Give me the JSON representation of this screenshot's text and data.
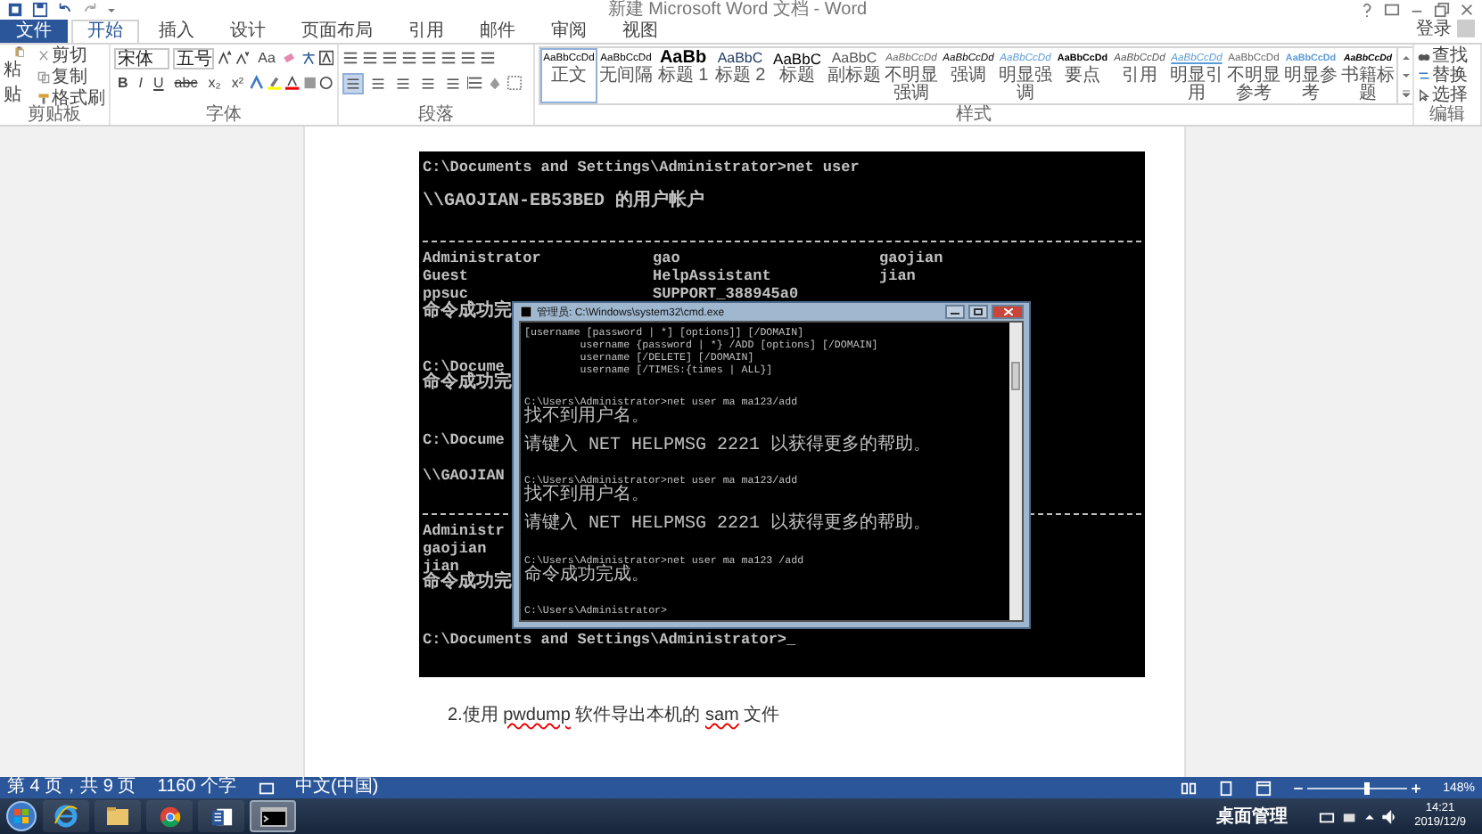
{
  "window": {
    "title": "新建 Microsoft Word 文档 - Word",
    "sign_in": "登录"
  },
  "tabs": [
    {
      "label": "文件",
      "kind": "file",
      "selected": false
    },
    {
      "label": "开始",
      "kind": "tab",
      "selected": true
    },
    {
      "label": "插入",
      "kind": "tab",
      "selected": false
    },
    {
      "label": "设计",
      "kind": "tab",
      "selected": false
    },
    {
      "label": "页面布局",
      "kind": "tab",
      "selected": false
    },
    {
      "label": "引用",
      "kind": "tab",
      "selected": false
    },
    {
      "label": "邮件",
      "kind": "tab",
      "selected": false
    },
    {
      "label": "审阅",
      "kind": "tab",
      "selected": false
    },
    {
      "label": "视图",
      "kind": "tab",
      "selected": false
    }
  ],
  "clipboard": {
    "paste": "粘贴",
    "cut": "剪切",
    "copy": "复制",
    "format_painter": "格式刷",
    "label": "剪贴板"
  },
  "font": {
    "name": "宋体",
    "size": "五号",
    "change_case": "Aa",
    "format_buttons": [
      "B",
      "I",
      "U",
      "abc",
      "x₂",
      "x²"
    ],
    "label": "字体"
  },
  "paragraph": {
    "alignment": [
      {
        "selected": true
      },
      {
        "selected": false
      },
      {
        "selected": false
      },
      {
        "selected": false
      },
      {
        "selected": false
      }
    ],
    "label": "段落"
  },
  "styles": {
    "items": [
      {
        "preview": "AaBbCcDd",
        "label": "正文",
        "kind": "normal",
        "selected": true
      },
      {
        "preview": "AaBbCcDd",
        "label": "无间隔",
        "kind": "normal",
        "selected": false
      },
      {
        "preview": "AaBb",
        "label": "标题 1",
        "kind": "heading1",
        "selected": false
      },
      {
        "preview": "AaBbC",
        "label": "标题 2",
        "kind": "heading2",
        "selected": false
      },
      {
        "preview": "AaBbC",
        "label": "标题",
        "kind": "title",
        "selected": false
      },
      {
        "preview": "AaBbC",
        "label": "副标题",
        "kind": "subtitle",
        "selected": false
      },
      {
        "preview": "AaBbCcDd",
        "label": "不明显强调",
        "kind": "subtle",
        "selected": false
      },
      {
        "preview": "AaBbCcDd",
        "label": "强调",
        "kind": "emphasis",
        "selected": false
      },
      {
        "preview": "AaBbCcDd",
        "label": "明显强调",
        "kind": "intense",
        "selected": false
      },
      {
        "preview": "AaBbCcDd",
        "label": "要点",
        "kind": "strong",
        "selected": false
      },
      {
        "preview": "AaBbCcDd",
        "label": "引用",
        "kind": "quote",
        "selected": false
      },
      {
        "preview": "AaBbCcDd",
        "label": "明显引用",
        "kind": "intensequote",
        "selected": false
      },
      {
        "preview": "AaBbCcDd",
        "label": "不明显参考",
        "kind": "subtleref",
        "selected": false
      },
      {
        "preview": "AaBbCcDd",
        "label": "明显参考",
        "kind": "intenseref",
        "selected": false
      },
      {
        "preview": "AaBbCcDd",
        "label": "书籍标题",
        "kind": "booktitle",
        "selected": false
      }
    ],
    "label": "样式"
  },
  "editing": {
    "find": "查找",
    "replace": "替换",
    "select": "选择",
    "label": "编辑"
  },
  "console": {
    "lines": [
      {
        "kind": "text",
        "text": "C:\\Documents and Settings\\Administrator>net user"
      },
      {
        "kind": "blank"
      },
      {
        "kind": "cjk",
        "text": "\\\\GAOJIAN-EB53BED 的用户帐户"
      },
      {
        "kind": "blank"
      },
      {
        "kind": "rule"
      },
      {
        "kind": "columns",
        "columns": [
          "Administrator",
          "gao",
          "gaojian"
        ]
      },
      {
        "kind": "columns",
        "columns": [
          "Guest",
          "HelpAssistant",
          "jian"
        ]
      },
      {
        "kind": "columns",
        "columns": [
          "ppsuc",
          "SUPPORT_388945a0"
        ]
      },
      {
        "kind": "cjk",
        "text": "命令成功完"
      },
      {
        "kind": "blank"
      },
      {
        "kind": "blank"
      },
      {
        "kind": "text",
        "text": "C:\\Docume"
      },
      {
        "kind": "cjk",
        "text": "命令成功完"
      },
      {
        "kind": "blank"
      },
      {
        "kind": "blank"
      },
      {
        "kind": "text",
        "text": "C:\\Docume"
      },
      {
        "kind": "blank"
      },
      {
        "kind": "text",
        "text": "\\\\GAOJIAN"
      },
      {
        "kind": "blank"
      },
      {
        "kind": "rule"
      },
      {
        "kind": "text",
        "text": "Administr"
      },
      {
        "kind": "text",
        "text": "gaojian"
      },
      {
        "kind": "text",
        "text": "jian"
      },
      {
        "kind": "cjk",
        "text": "命令成功完"
      },
      {
        "kind": "blank"
      },
      {
        "kind": "blank"
      },
      {
        "kind": "text",
        "text": "C:\\Documents and Settings\\Administrator>_"
      }
    ],
    "window": {
      "title": "管理员: C:\\Windows\\system32\\cmd.exe",
      "lines": [
        {
          "kind": "text",
          "text": "[username [password | *] [options]] [/DOMAIN]"
        },
        {
          "kind": "text",
          "text": "         username {password | *} /ADD [options] [/DOMAIN]"
        },
        {
          "kind": "text",
          "text": "         username [/DELETE] [/DOMAIN]"
        },
        {
          "kind": "text",
          "text": "         username [/TIMES:{times | ALL}]"
        },
        {
          "kind": "blank"
        },
        {
          "kind": "blank"
        },
        {
          "kind": "text",
          "text": "C:\\Users\\Administrator>net user ma ma123/add"
        },
        {
          "kind": "cjk",
          "text": "找不到用户名。"
        },
        {
          "kind": "blank"
        },
        {
          "kind": "cjk",
          "text": "请键入 NET HELPMSG 2221 以获得更多的帮助。"
        },
        {
          "kind": "blank"
        },
        {
          "kind": "blank"
        },
        {
          "kind": "text",
          "text": "C:\\Users\\Administrator>net user ma ma123/add"
        },
        {
          "kind": "cjk",
          "text": "找不到用户名。"
        },
        {
          "kind": "blank"
        },
        {
          "kind": "cjk",
          "text": "请键入 NET HELPMSG 2221 以获得更多的帮助。"
        },
        {
          "kind": "blank"
        },
        {
          "kind": "blank"
        },
        {
          "kind": "text",
          "text": "C:\\Users\\Administrator>net user ma ma123 /add"
        },
        {
          "kind": "cjk",
          "text": "命令成功完成。"
        },
        {
          "kind": "blank"
        },
        {
          "kind": "blank"
        },
        {
          "kind": "text",
          "text": "C:\\Users\\Administrator>"
        }
      ]
    }
  },
  "paragraph_text": [
    {
      "text": "2.使用 ",
      "misspelled": false
    },
    {
      "text": "pwdump",
      "misspelled": true
    },
    {
      "text": " 软件导出本机的 ",
      "misspelled": false
    },
    {
      "text": "sam",
      "misspelled": true
    },
    {
      "text": " 文件",
      "misspelled": false
    }
  ],
  "status_bar": {
    "page": "第 4 页，共 9 页",
    "words": "1160 个字",
    "language": "中文(中国)",
    "zoom": "148%",
    "zoom_level": {
      "level": 0.6
    }
  },
  "taskbar": {
    "apps": [
      {
        "kind": "ie",
        "selected": false
      },
      {
        "kind": "folder",
        "selected": false
      },
      {
        "kind": "chrome",
        "selected": false
      },
      {
        "kind": "word",
        "selected": false
      },
      {
        "kind": "cmd",
        "selected": true
      }
    ],
    "toolbar": "桌面管理",
    "time": "14:21",
    "date": "2019/12/9"
  }
}
